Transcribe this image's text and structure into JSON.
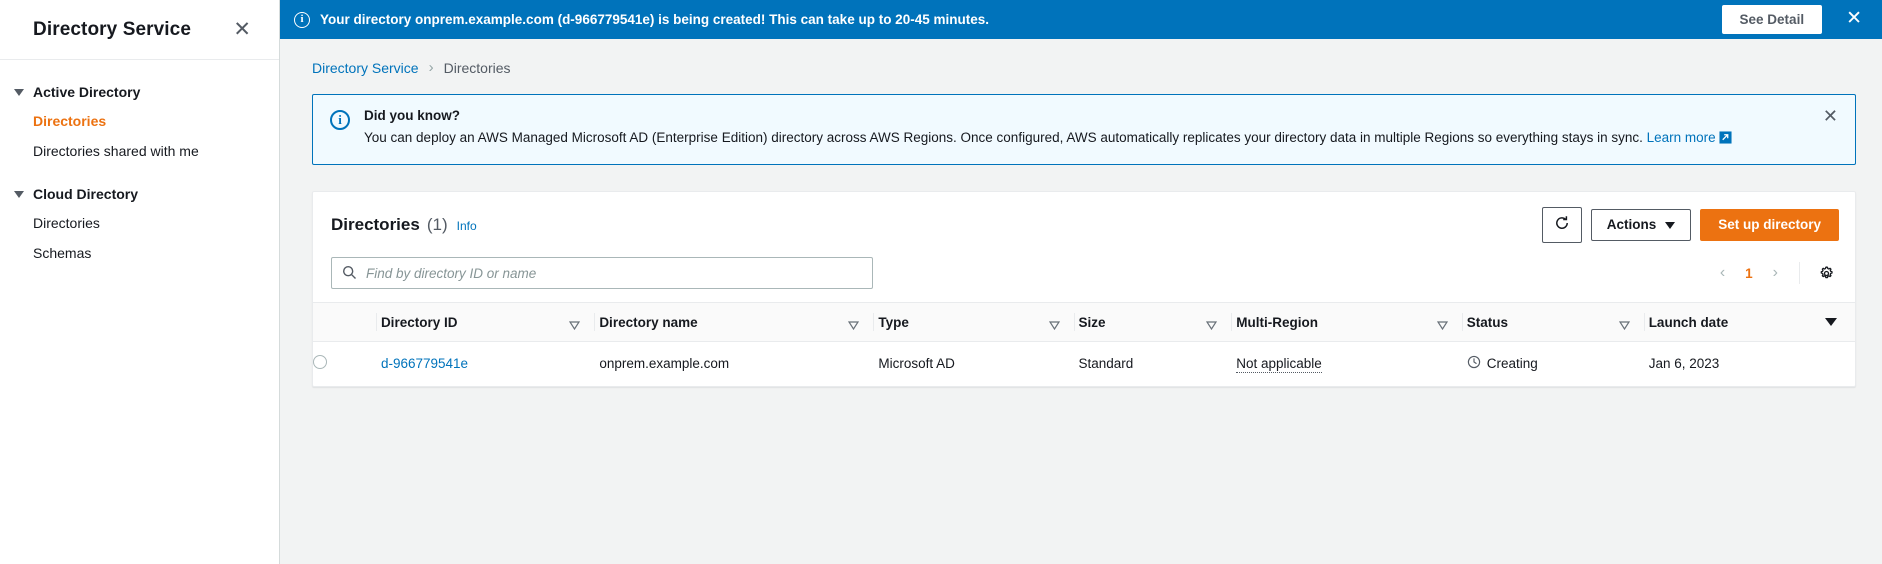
{
  "sidebar": {
    "title": "Directory Service",
    "close_icon": "close-icon",
    "groups": [
      {
        "label": "Active Directory",
        "items": [
          {
            "label": "Directories",
            "active": true
          },
          {
            "label": "Directories shared with me",
            "active": false
          }
        ]
      },
      {
        "label": "Cloud Directory",
        "items": [
          {
            "label": "Directories",
            "active": false
          },
          {
            "label": "Schemas",
            "active": false
          }
        ]
      }
    ]
  },
  "flashbar": {
    "icon": "info-icon",
    "message": "Your directory onprem.example.com (d-966779541e) is being created! This can take up to 20-45 minutes.",
    "button_label": "See Detail",
    "close_icon": "close-icon",
    "background": "#0073bb"
  },
  "breadcrumb": {
    "root": "Directory Service",
    "separator": "›",
    "current": "Directories"
  },
  "alert": {
    "icon": "info-icon",
    "title": "Did you know?",
    "description": "You can deploy an AWS Managed Microsoft AD (Enterprise Edition) directory across AWS Regions. Once configured, AWS automatically replicates your directory data in multiple Regions so everything stays in sync.",
    "link_text_1": "Learn",
    "link_text_2": "more",
    "external_icon": "external-link-icon",
    "close_icon": "close-icon",
    "border_color": "#0073bb",
    "background": "#f1faff"
  },
  "panel": {
    "title": "Directories",
    "count": "(1)",
    "info_label": "Info",
    "refresh_icon": "refresh-icon",
    "actions_label": "Actions",
    "actions_caret": "chevron-down-icon",
    "primary_label": "Set up directory",
    "primary_color": "#ec7211"
  },
  "search": {
    "icon": "search-icon",
    "placeholder": "Find by directory ID or name",
    "value": ""
  },
  "pagination": {
    "prev_icon": "chevron-left-icon",
    "page": "1",
    "next_icon": "chevron-right-icon",
    "settings_icon": "gear-icon"
  },
  "table": {
    "columns": [
      {
        "label": "Directory ID",
        "sort": "unsorted"
      },
      {
        "label": "Directory name",
        "sort": "unsorted"
      },
      {
        "label": "Type",
        "sort": "unsorted"
      },
      {
        "label": "Size",
        "sort": "unsorted"
      },
      {
        "label": "Multi-Region",
        "sort": "unsorted"
      },
      {
        "label": "Status",
        "sort": "unsorted"
      },
      {
        "label": "Launch date",
        "sort": "sorted"
      }
    ],
    "rows": [
      {
        "selected": false,
        "directory_id": "d-966779541e",
        "directory_name": "onprem.example.com",
        "type": "Microsoft AD",
        "size": "Standard",
        "multi_region": "Not applicable",
        "status": "Creating",
        "status_icon": "pending-clock-icon",
        "launch_date": "Jan 6, 2023"
      }
    ]
  }
}
